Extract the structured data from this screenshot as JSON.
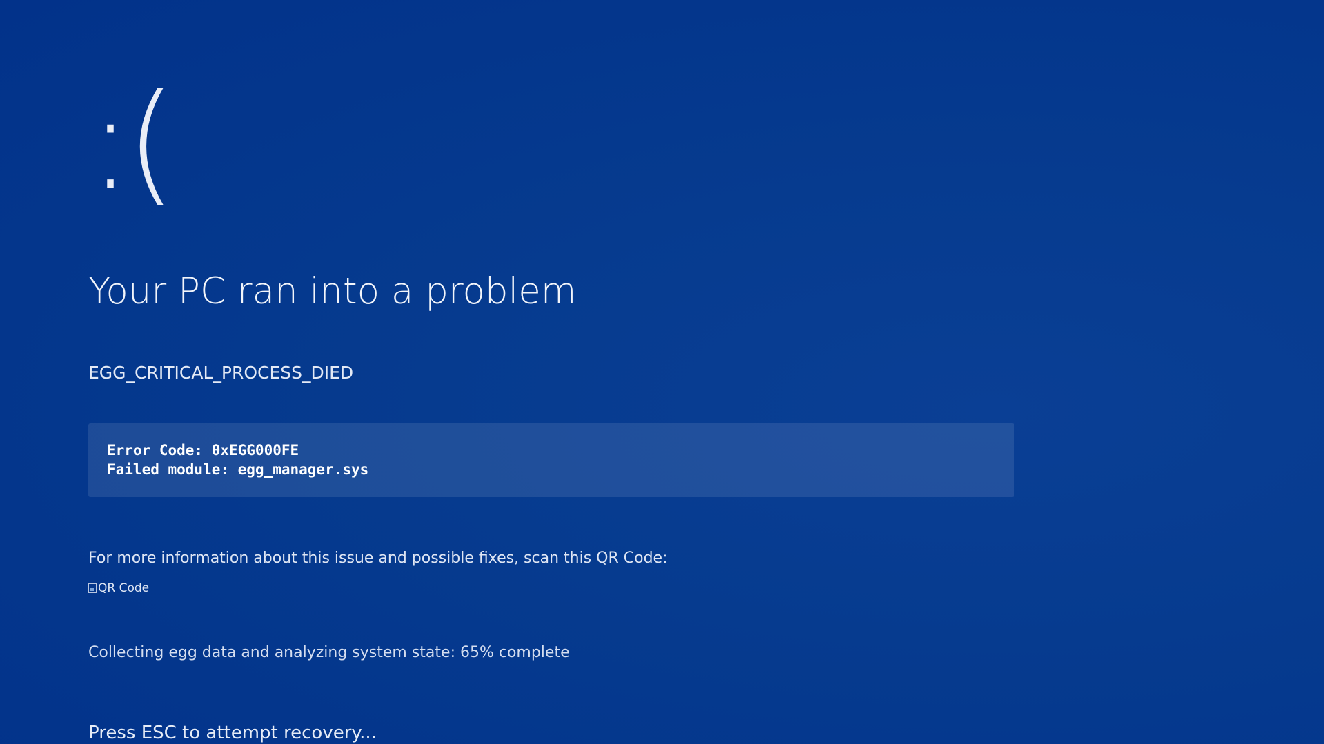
{
  "screen": {
    "sad_face": ":(",
    "title": "Your PC ran into a problem",
    "stop_code": "EGG_CRITICAL_PROCESS_DIED",
    "error_code_line": "Error Code: 0xEGG000FE",
    "failed_module_line": "Failed module: egg_manager.sys",
    "info_text": "For more information about this issue and possible fixes, scan this QR Code:",
    "qr_alt": "QR Code",
    "progress_text": "Collecting egg data and analyzing system state: 65% complete",
    "progress_percent": 65,
    "esc_hint": "Press ESC to attempt recovery..."
  },
  "colors": {
    "background": "#063b8f",
    "text": "#ffffff",
    "code_box": "rgba(255,255,255,0.10)"
  }
}
